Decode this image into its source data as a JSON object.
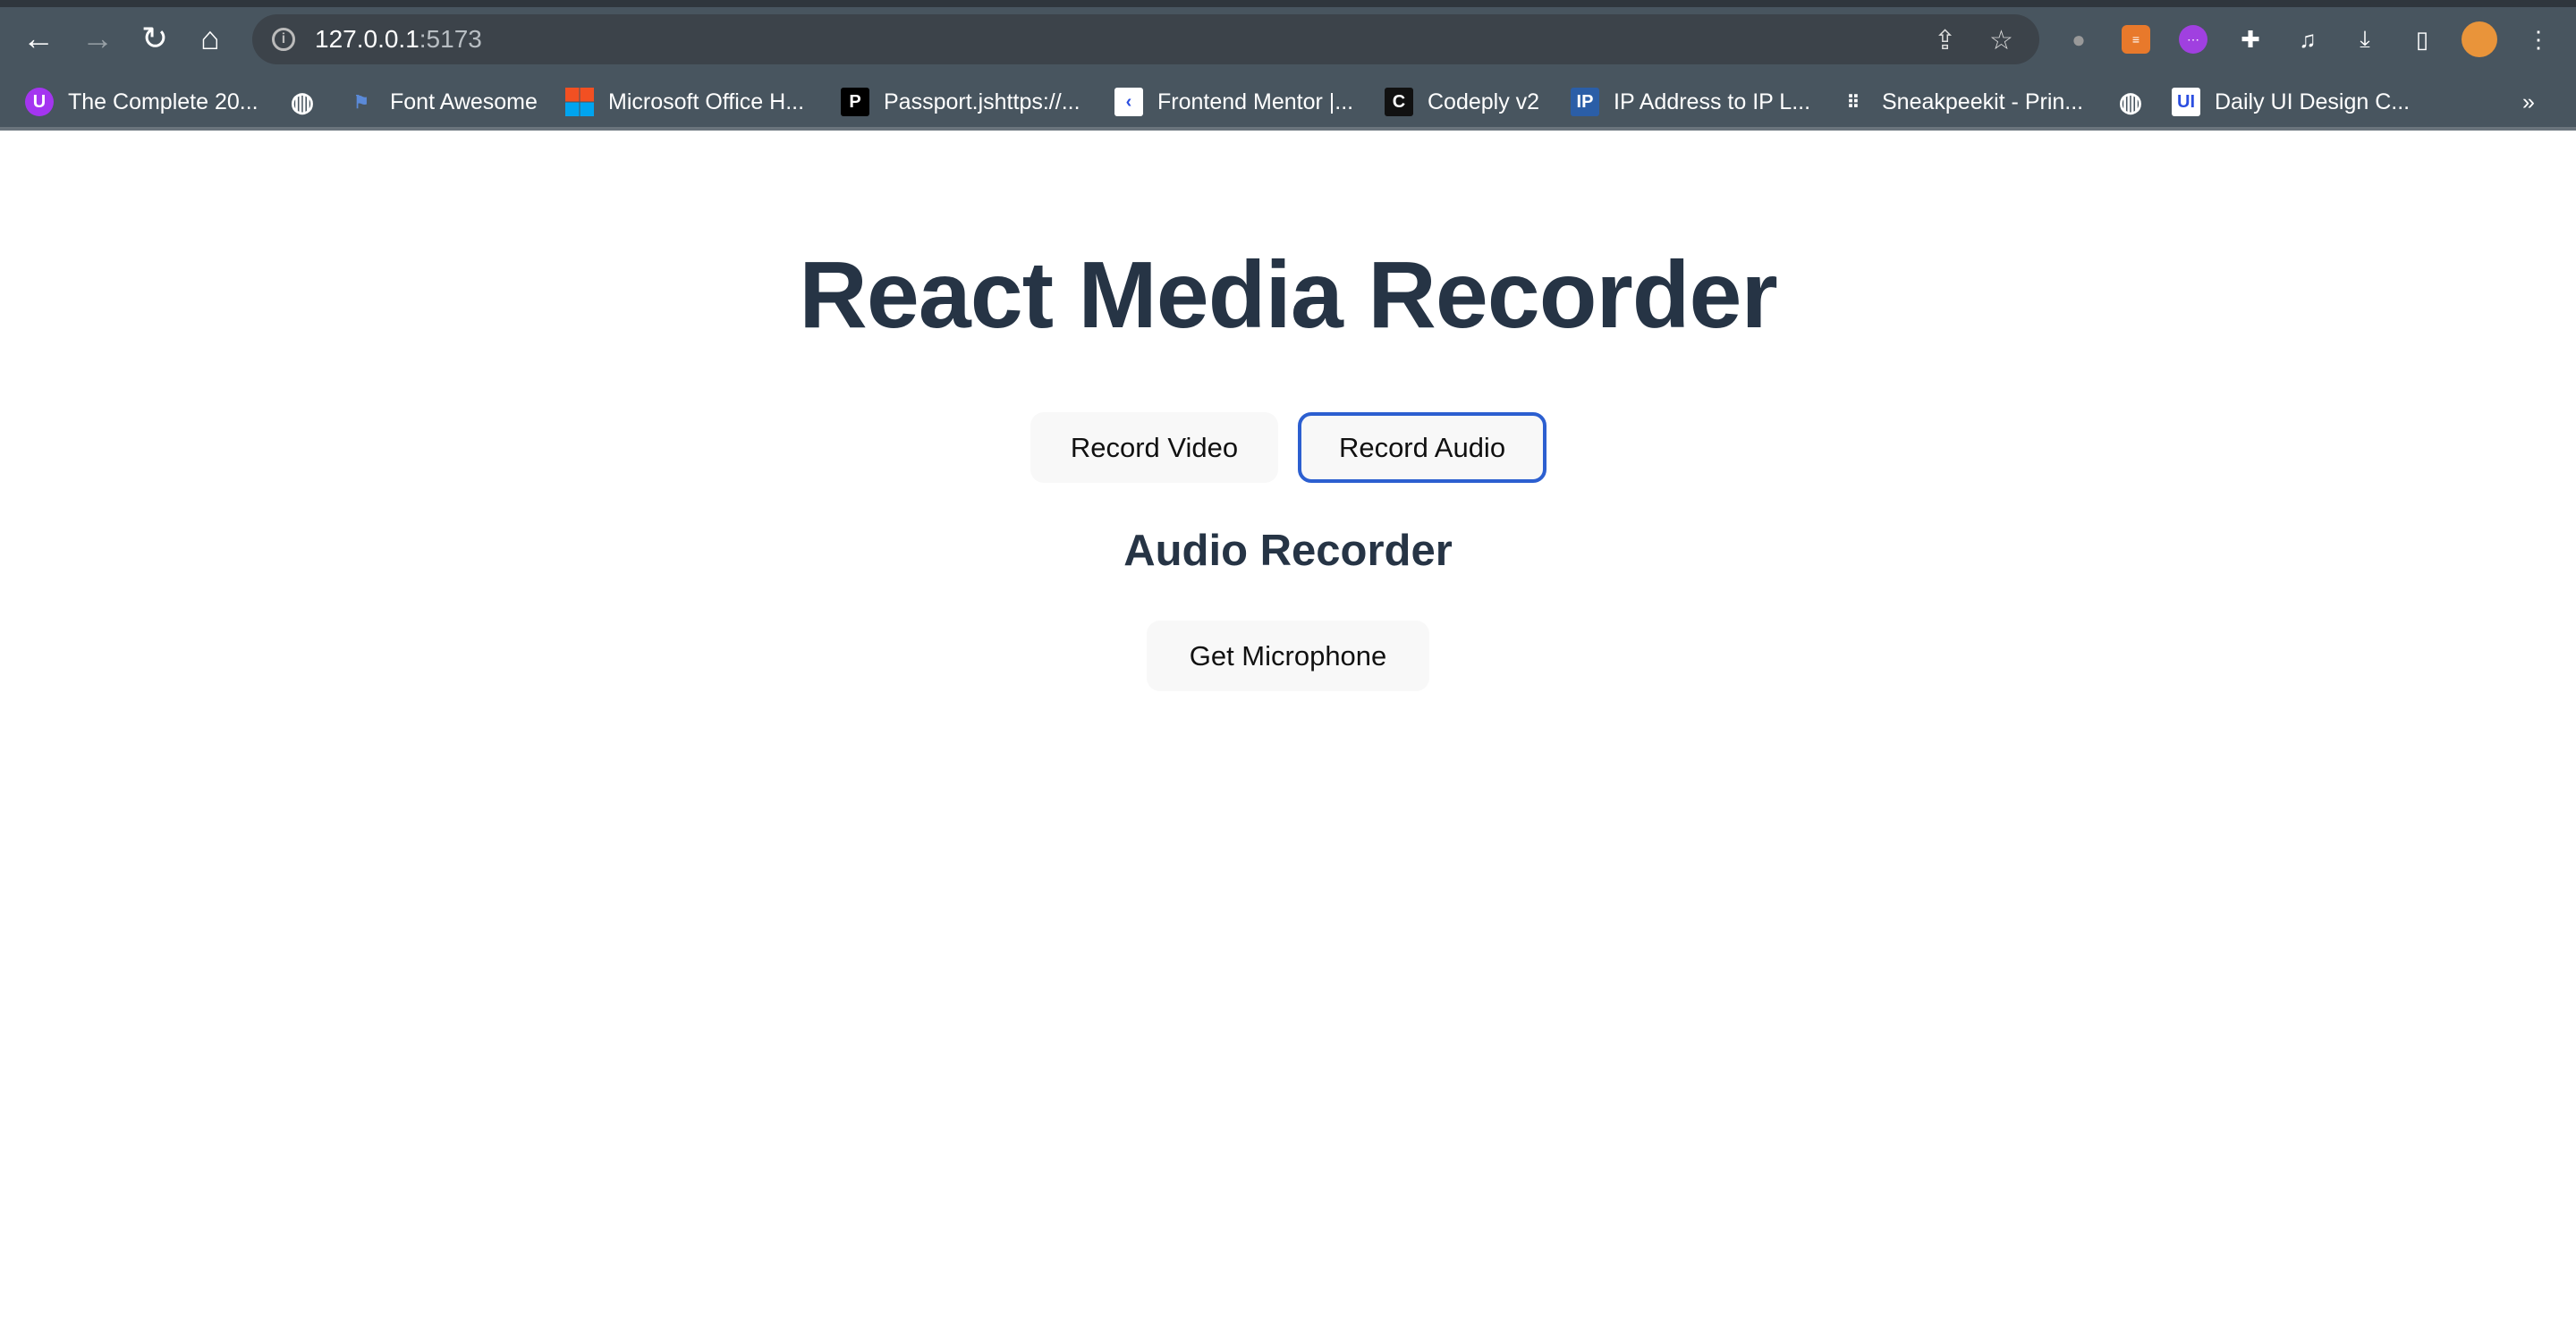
{
  "browser": {
    "url_host": "127.0.0.1",
    "url_port": ":5173",
    "bookmarks": [
      {
        "label": "The Complete 20...",
        "icon": "udemy-icon",
        "color": "#a435f0",
        "glyph": "U"
      },
      {
        "label": "",
        "icon": "globe-icon",
        "color": "",
        "glyph": "◍"
      },
      {
        "label": "Font Awesome",
        "icon": "flag-icon",
        "color": "",
        "glyph": "⚑"
      },
      {
        "label": "Microsoft Office H...",
        "icon": "microsoft-icon",
        "color": "",
        "glyph": ""
      },
      {
        "label": "Passport.jshttps://...",
        "icon": "passport-icon",
        "color": "#000000",
        "glyph": "P"
      },
      {
        "label": "Frontend Mentor |...",
        "icon": "frontend-mentor-icon",
        "color": "#ffffff",
        "glyph": "‹"
      },
      {
        "label": "Codeply v2",
        "icon": "codeply-icon",
        "color": "#111111",
        "glyph": "C"
      },
      {
        "label": "IP Address to IP L...",
        "icon": "ip-icon",
        "color": "#2b5ea7",
        "glyph": "IP"
      },
      {
        "label": "Sneakpeekit - Prin...",
        "icon": "dots-grid-icon",
        "color": "",
        "glyph": "⠿"
      },
      {
        "label": "",
        "icon": "globe-icon",
        "color": "",
        "glyph": "◍"
      },
      {
        "label": "Daily UI Design C...",
        "icon": "dailyui-icon",
        "color": "#ffffff",
        "glyph": "UI"
      }
    ],
    "overflow": "»"
  },
  "page": {
    "title": "React Media Recorder",
    "buttons": {
      "record_video": "Record Video",
      "record_audio": "Record Audio"
    },
    "subtitle": "Audio Recorder",
    "get_microphone": "Get Microphone"
  },
  "colors": {
    "heading": "#263445",
    "active_border": "#2c5fd0",
    "button_bg": "#f8f8f8"
  }
}
